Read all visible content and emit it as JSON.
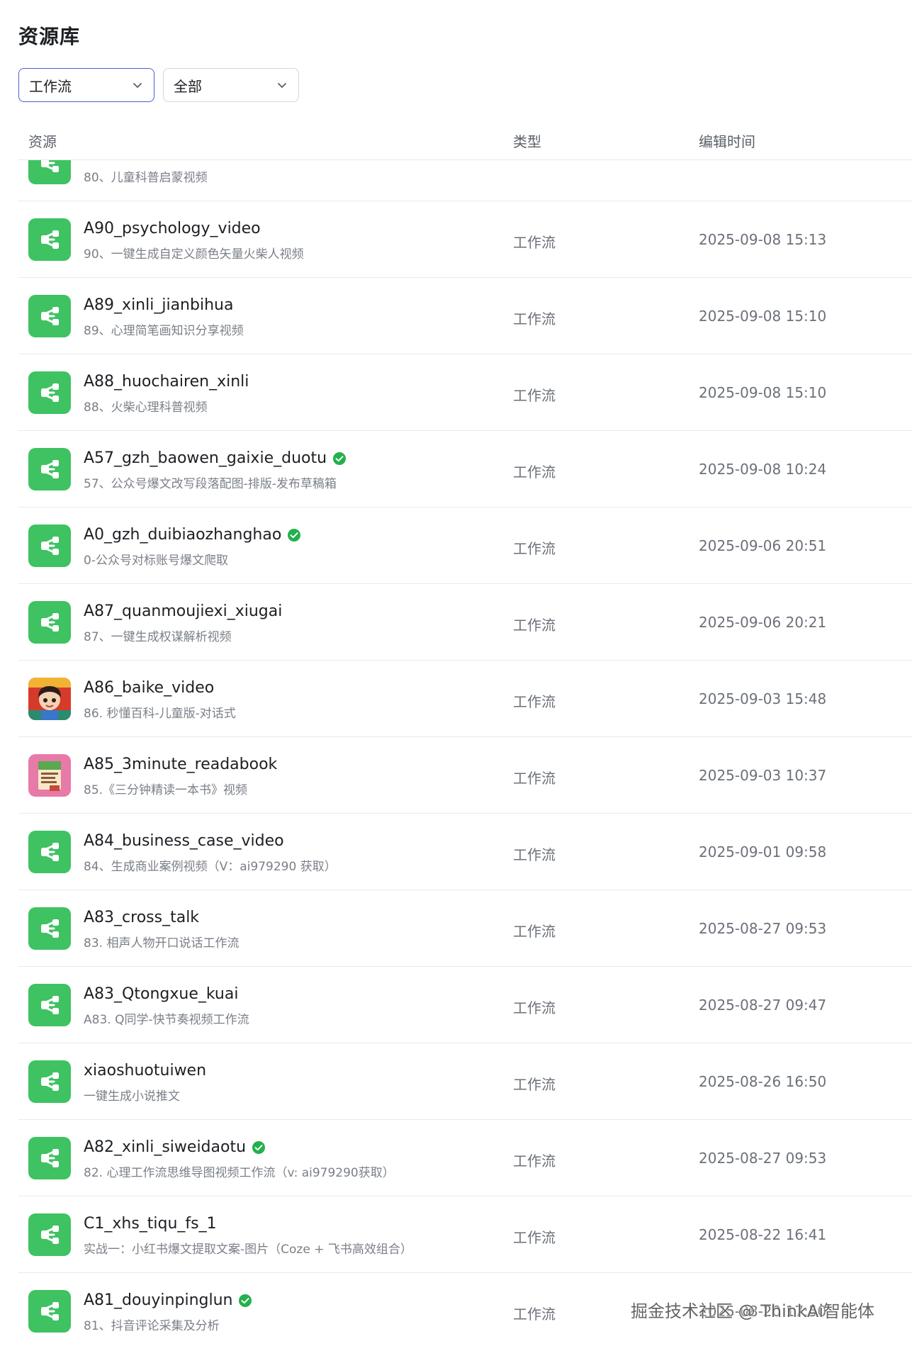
{
  "page": {
    "title": "资源库"
  },
  "filters": {
    "type_value": "工作流",
    "scope_value": "全部"
  },
  "table": {
    "headers": [
      "资源",
      "类型",
      "编辑时间"
    ],
    "rows": [
      {
        "name": "",
        "desc": "80、儿童科普启蒙视频",
        "type": "",
        "time": "",
        "icon": "workflow-icon",
        "verified": false
      },
      {
        "name": "A90_psychology_video",
        "desc": "90、一键生成自定义颜色矢量火柴人视频",
        "type": "工作流",
        "time": "2025-09-08 15:13",
        "icon": "workflow-icon",
        "verified": false
      },
      {
        "name": "A89_xinli_jianbihua",
        "desc": "89、心理简笔画知识分享视频",
        "type": "工作流",
        "time": "2025-09-08 15:10",
        "icon": "workflow-icon",
        "verified": false
      },
      {
        "name": "A88_huochairen_xinli",
        "desc": "88、火柴心理科普视频",
        "type": "工作流",
        "time": "2025-09-08 15:10",
        "icon": "workflow-icon",
        "verified": false
      },
      {
        "name": "A57_gzh_baowen_gaixie_duotu",
        "desc": "57、公众号爆文改写段落配图-排版-发布草稿箱",
        "type": "工作流",
        "time": "2025-09-08 10:24",
        "icon": "workflow-icon",
        "verified": true
      },
      {
        "name": "A0_gzh_duibiaozhanghao",
        "desc": "0-公众号对标账号爆文爬取",
        "type": "工作流",
        "time": "2025-09-06 20:51",
        "icon": "workflow-icon",
        "verified": true
      },
      {
        "name": "A87_quanmoujiexi_xiugai",
        "desc": "87、一键生成权谋解析视频",
        "type": "工作流",
        "time": "2025-09-06 20:21",
        "icon": "workflow-icon",
        "verified": false
      },
      {
        "name": "A86_baike_video",
        "desc": "86. 秒懂百科-儿童版-对话式",
        "type": "工作流",
        "time": "2025-09-03 15:48",
        "icon": "cartoon-child-avatar-icon",
        "verified": false
      },
      {
        "name": "A85_3minute_readabook",
        "desc": "85.《三分钟精读一本书》视频",
        "type": "工作流",
        "time": "2025-09-03 10:37",
        "icon": "book-icon",
        "verified": false
      },
      {
        "name": "A84_business_case_video",
        "desc": "84、生成商业案例视频（V：ai979290 获取）",
        "type": "工作流",
        "time": "2025-09-01 09:58",
        "icon": "workflow-icon",
        "verified": false
      },
      {
        "name": "A83_cross_talk",
        "desc": "83. 相声人物开口说话工作流",
        "type": "工作流",
        "time": "2025-08-27 09:53",
        "icon": "workflow-icon",
        "verified": false
      },
      {
        "name": "A83_Qtongxue_kuai",
        "desc": "A83. Q同学-快节奏视频工作流",
        "type": "工作流",
        "time": "2025-08-27 09:47",
        "icon": "workflow-icon",
        "verified": false
      },
      {
        "name": "xiaoshuotuiwen",
        "desc": "一键生成小说推文",
        "type": "工作流",
        "time": "2025-08-26 16:50",
        "icon": "workflow-icon",
        "verified": false
      },
      {
        "name": "A82_xinli_siweidaotu",
        "desc": "82. 心理工作流思维导图视频工作流（v: ai979290获取）",
        "type": "工作流",
        "time": "2025-08-27 09:53",
        "icon": "workflow-icon",
        "verified": true
      },
      {
        "name": "C1_xhs_tiqu_fs_1",
        "desc": "实战一：小红书爆文提取文案-图片（Coze + 飞书高效组合）",
        "type": "工作流",
        "time": "2025-08-22 16:41",
        "icon": "workflow-icon",
        "verified": false
      },
      {
        "name": "A81_douyinpinglun",
        "desc": "81、抖音评论采集及分析",
        "type": "工作流",
        "time": "2025-08-20 17:50",
        "icon": "workflow-icon",
        "verified": true
      }
    ]
  },
  "watermark": {
    "text": "掘金技术社区 @ ThinkAi智能体"
  },
  "colors": {
    "workflow_icon_bg": "#3ec262",
    "select_active_border": "#4c5fd6",
    "verified_green": "#22b14c"
  }
}
